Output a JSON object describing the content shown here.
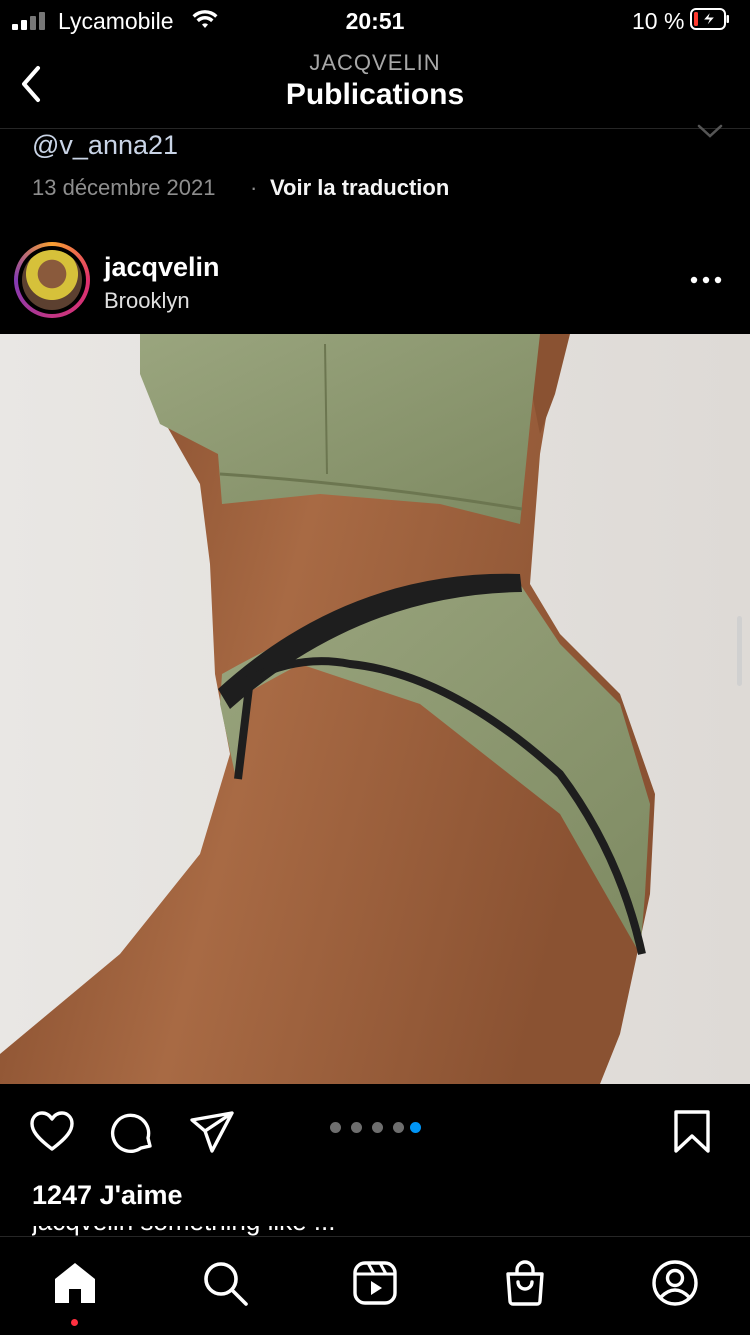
{
  "status_bar": {
    "carrier": "Lycamobile",
    "time": "20:51",
    "battery": "10 %"
  },
  "nav": {
    "subtitle": "JACQVELIN",
    "title": "Publications"
  },
  "previous_post": {
    "handle": "@v_anna21",
    "date": "13 décembre 2021",
    "separator": "·",
    "translate": "Voir la traduction"
  },
  "post": {
    "username": "jacqvelin",
    "location": "Brooklyn",
    "carousel": {
      "count": 5,
      "active_index": 4
    },
    "likes": "1247 J'aime",
    "caption_partial": "jacqvelin something like ... "
  },
  "icons": {
    "back": "chevron-left-icon",
    "more": "more-horizontal-icon",
    "like": "heart-icon",
    "comment": "comment-icon",
    "share": "send-icon",
    "save": "bookmark-icon",
    "tabs": [
      "home-icon",
      "search-icon",
      "reels-icon",
      "shop-icon",
      "profile-icon"
    ]
  },
  "colors": {
    "background": "#000000",
    "active_dot": "#0095f6",
    "notification_dot": "#ff3040",
    "battery_low": "#ff3b30"
  }
}
